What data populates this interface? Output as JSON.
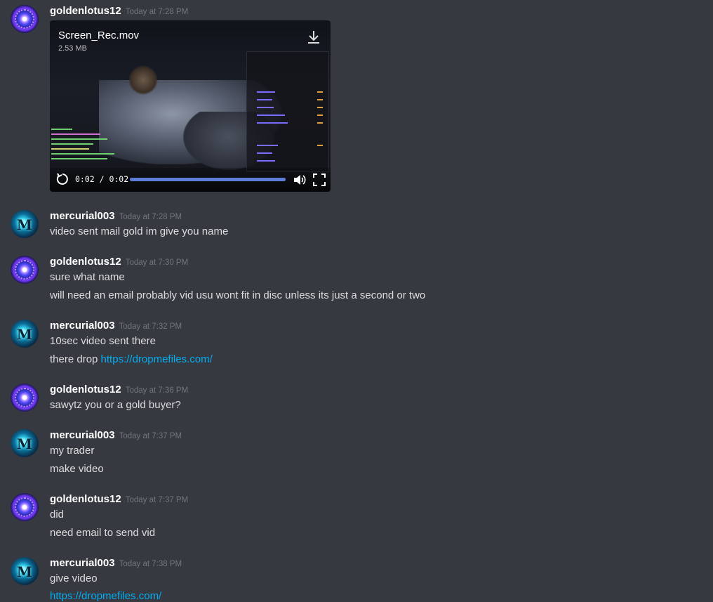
{
  "messages": [
    {
      "author": "goldenlotus12",
      "time": "Today at 7:28 PM",
      "avatar": "lotus-avatar",
      "attachment": {
        "filename": "Screen_Rec.mov",
        "size": "2.53 MB",
        "time_display": "0:02 / 0:02",
        "progress": 1.0
      }
    },
    {
      "author": "mercurial003",
      "time": "Today at 7:28 PM",
      "avatar": "mercurial-avatar",
      "lines": [
        "video sent mail gold im give you name"
      ]
    },
    {
      "author": "goldenlotus12",
      "time": "Today at 7:30 PM",
      "avatar": "lotus-avatar",
      "lines": [
        "sure what name",
        "will need an email probably vid usu wont fit in disc unless its just a second or two"
      ]
    },
    {
      "author": "mercurial003",
      "time": "Today at 7:32 PM",
      "avatar": "mercurial-avatar",
      "lines": [
        "10sec video sent there"
      ],
      "line2_prefix": "there drop ",
      "line2_link": "https://dropmefiles.com/"
    },
    {
      "author": "goldenlotus12",
      "time": "Today at 7:36 PM",
      "avatar": "lotus-avatar",
      "lines": [
        "sawytz you or  a gold buyer?"
      ]
    },
    {
      "author": "mercurial003",
      "time": "Today at 7:37 PM",
      "avatar": "mercurial-avatar",
      "lines": [
        "my trader",
        "make video"
      ]
    },
    {
      "author": "goldenlotus12",
      "time": "Today at 7:37 PM",
      "avatar": "lotus-avatar",
      "lines": [
        "did",
        "need email to send vid"
      ]
    },
    {
      "author": "mercurial003",
      "time": "Today at 7:38 PM",
      "avatar": "mercurial-avatar",
      "lines": [
        "give video"
      ],
      "link": "https://dropmefiles.com/"
    }
  ],
  "avatar_glyph": "M",
  "colors": {
    "background": "#36393f",
    "link": "#00aff4",
    "username": "#ffffff",
    "timestamp": "#72767d",
    "progress": "#5d7dd9"
  }
}
